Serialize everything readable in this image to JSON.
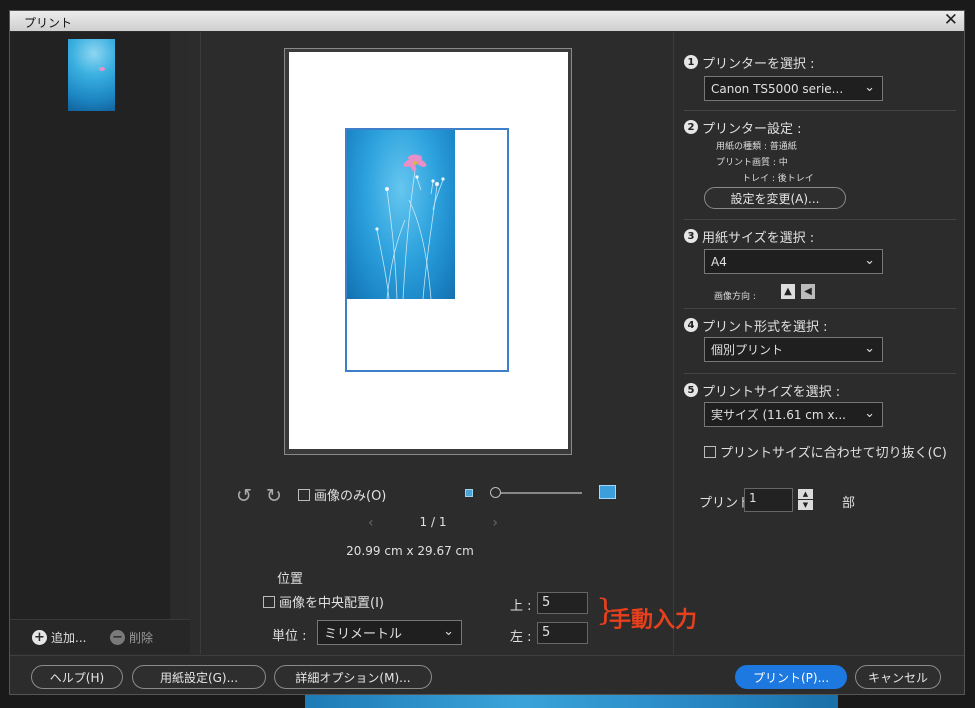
{
  "window": {
    "title": "プリント",
    "close_glyph": "✕"
  },
  "filmstrip": {
    "add_label": "追加...",
    "remove_label": "削除"
  },
  "preview": {
    "image_only_label": "画像のみ(O)",
    "page_indicator": "1 / 1",
    "paper_dimensions": "20.99 cm x 29.67 cm"
  },
  "position": {
    "title": "位置",
    "center_label": "画像を中央配置(I)",
    "unit_label": "単位 :",
    "unit_value": "ミリメートル",
    "top_label": "上 :",
    "top_value": "5",
    "left_label": "左 :",
    "left_value": "5"
  },
  "annotation": {
    "brace": "}",
    "text": "手動入力",
    "color": "#e8401c"
  },
  "steps": {
    "printer": {
      "num": "1",
      "label": "プリンターを選択 :",
      "value": "Canon TS5000 serie..."
    },
    "printer_settings": {
      "num": "2",
      "label": "プリンター設定 :",
      "paper_type": "用紙の種類 : 普通紙",
      "quality": "プリント画質 : 中",
      "tray": "トレイ : 後トレイ",
      "change_button": "設定を変更(A)..."
    },
    "paper_size": {
      "num": "3",
      "label": "用紙サイズを選択 :",
      "value": "A4",
      "orientation_label": "画像方向 :"
    },
    "print_type": {
      "num": "4",
      "label": "プリント形式を選択 :",
      "value": "個別プリント"
    },
    "print_size": {
      "num": "5",
      "label": "プリントサイズを選択 :",
      "value": "実サイズ (11.61 cm x..."
    },
    "crop_label": "プリントサイズに合わせて切り抜く(C)",
    "copies_label": "プリント",
    "copies_value": "1",
    "copies_unit": "部"
  },
  "buttons": {
    "help": "ヘルプ(H)",
    "page_setup": "用紙設定(G)...",
    "more_options": "詳細オプション(M)...",
    "print": "プリント(P)...",
    "cancel": "キャンセル"
  },
  "colors": {
    "accent": "#1d78e0",
    "print_border": "#3d7fc9"
  }
}
